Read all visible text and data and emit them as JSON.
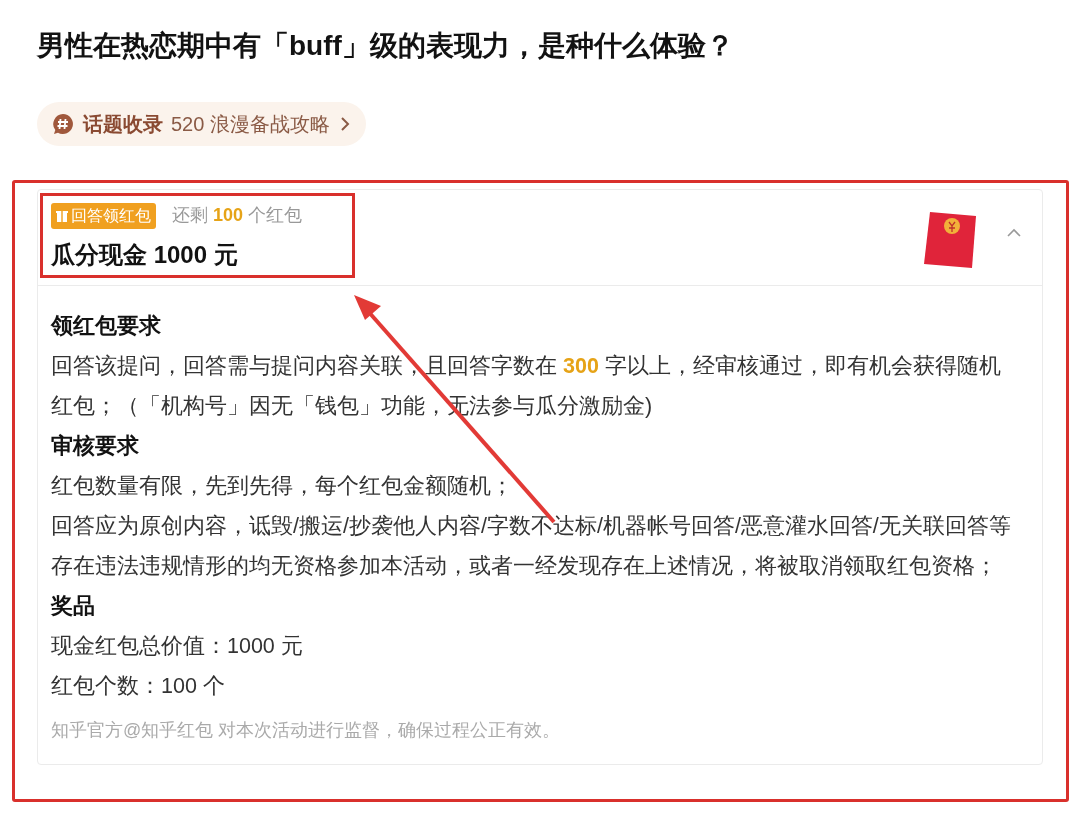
{
  "question": {
    "title": "男性在热恋期中有「buff」级的表现力，是种什么体验？"
  },
  "topic_pill": {
    "label": "话题收录",
    "name": "520 浪漫备战攻略"
  },
  "reward_card": {
    "expanded": true,
    "badge": "回答领红包",
    "remaining": [
      {
        "text": "还剩 ",
        "kind": "plain"
      },
      {
        "text": "100",
        "kind": "highlight"
      },
      {
        "text": " 个红包",
        "kind": "plain"
      }
    ],
    "title": "瓜分现金 1000 元",
    "sections": [
      {
        "heading": "领红包要求",
        "paragraphs": [
          [
            {
              "text": "回答该提问，回答需与提问内容关联，且回答字数在 ",
              "kind": "plain"
            },
            {
              "text": "300",
              "kind": "highlight"
            },
            {
              "text": " 字以上，经审核通过，即有机会获得随机红包；（「机构号」因无「钱包」功能，无法参与瓜分激励金)",
              "kind": "plain"
            }
          ]
        ]
      },
      {
        "heading": "审核要求",
        "paragraphs": [
          [
            {
              "text": "红包数量有限，先到先得，每个红包金额随机；",
              "kind": "plain"
            }
          ],
          [
            {
              "text": "回答应为原创内容，诋毁/搬运/抄袭他人内容/字数不达标/机器帐号回答/恶意灌水回答/无关联回答等存在违法违规情形的均无资格参加本活动，或者一经发现存在上述情况，将被取消领取红包资格；",
              "kind": "plain"
            }
          ]
        ]
      },
      {
        "heading": "奖品",
        "paragraphs": [
          [
            {
              "text": "现金红包总价值：1000 元",
              "kind": "plain"
            }
          ],
          [
            {
              "text": "红包个数：100 个",
              "kind": "plain"
            }
          ]
        ]
      }
    ],
    "footer": "知乎官方@知乎红包 对本次活动进行监督，确保过程公正有效。"
  }
}
